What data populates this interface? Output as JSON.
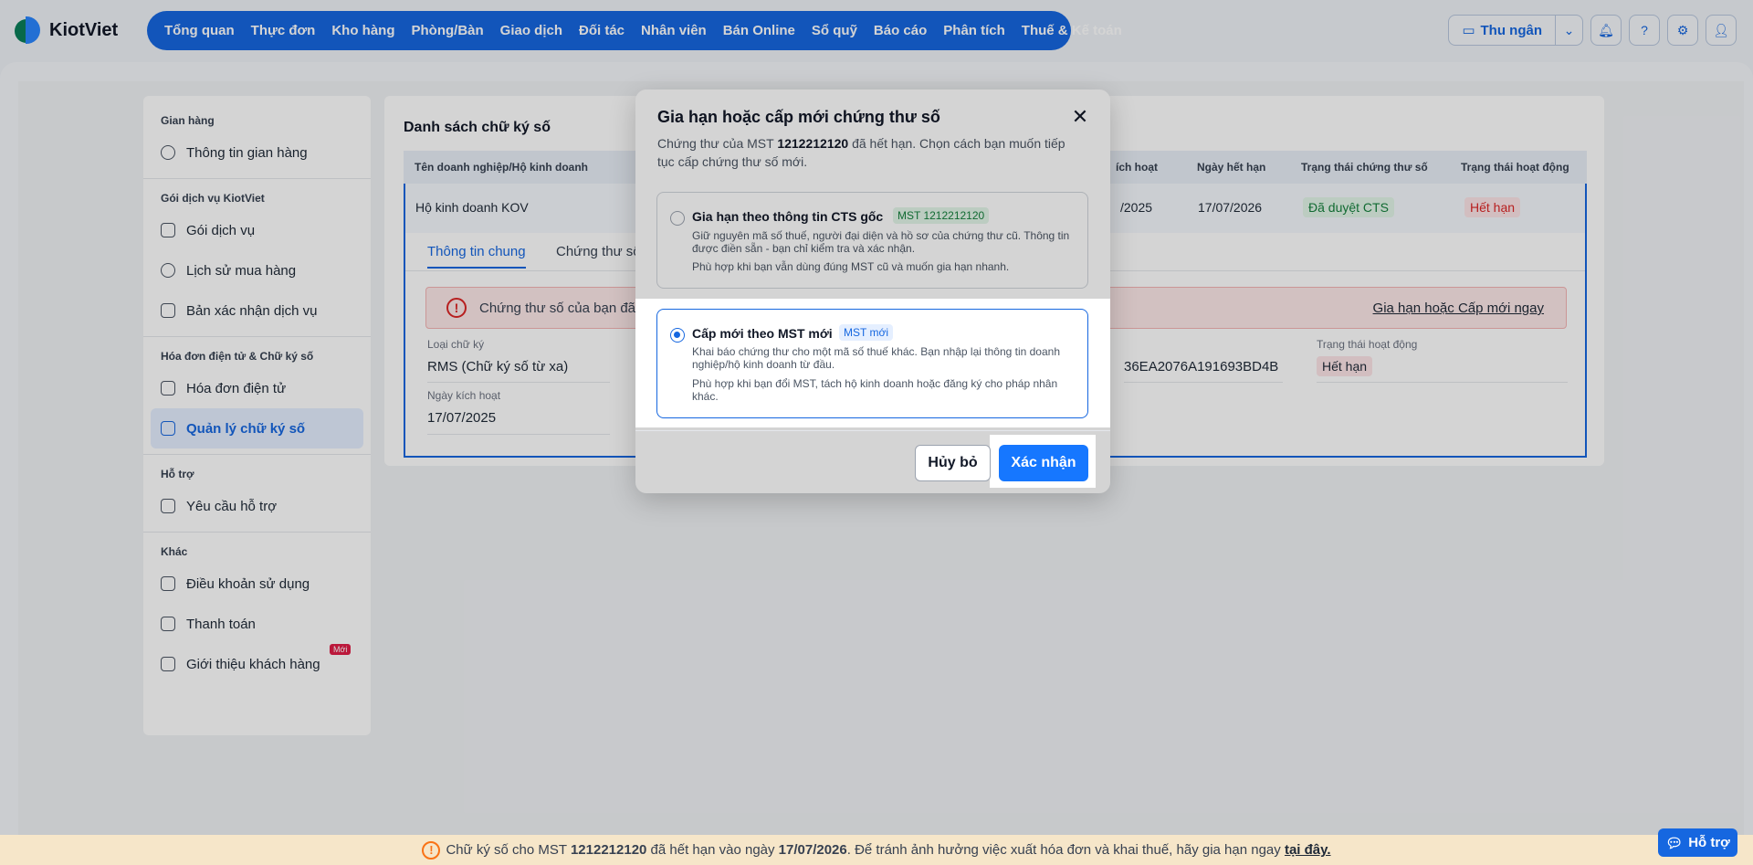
{
  "brand": {
    "name": "KiotViet"
  },
  "nav": [
    "Tổng quan",
    "Thực đơn",
    "Kho hàng",
    "Phòng/Bàn",
    "Giao dịch",
    "Đối tác",
    "Nhân viên",
    "Bán Online",
    "Sổ quỹ",
    "Báo cáo",
    "Phân tích",
    "Thuế & Kế toán"
  ],
  "toolbar": {
    "cashier_label": "Thu ngân"
  },
  "sidebar": {
    "groups": [
      {
        "title": "Gian hàng",
        "items": [
          "Thông tin gian hàng"
        ]
      },
      {
        "title": "Gói dịch vụ KiotViet",
        "items": [
          "Gói dịch vụ",
          "Lịch sử mua hàng",
          "Bản xác nhận dịch vụ"
        ]
      },
      {
        "title": "Hóa đơn điện tử & Chữ ký số",
        "items": [
          "Hóa đơn điện tử",
          "Quản lý chữ ký số"
        ]
      },
      {
        "title": "Hỗ trợ",
        "items": [
          "Yêu cầu hỗ trợ"
        ]
      },
      {
        "title": "Khác",
        "items": [
          "Điều khoản sử dụng",
          "Thanh toán",
          "Giới thiệu khách hàng"
        ]
      }
    ],
    "new_badge": "Mới"
  },
  "main": {
    "title": "Danh sách chữ ký số",
    "columns": [
      "Tên doanh nghiệp/Hộ kinh doanh",
      "ích hoạt",
      "Ngày hết hạn",
      "Trạng thái chứng thư số",
      "Trạng thái hoạt động"
    ],
    "row": {
      "name": "Hộ kinh doanh KOV",
      "activated": "/2025",
      "expiry": "17/07/2026",
      "cert_status": "Đã duyệt CTS",
      "op_status": "Hết hạn"
    },
    "tabs": [
      "Thông tin chung",
      "Chứng thư số"
    ],
    "alert": {
      "text": "Chứng thư số của bạn đã",
      "link": "Gia hạn hoặc Cấp mới ngay"
    },
    "fields": {
      "type_label": "Loại chữ ký",
      "type_value": "RMS (Chữ ký số từ xa)",
      "activated_label": "Ngày kích hoạt",
      "activated_value": "17/07/2025",
      "serial_value": "36EA2076A191693BD4B",
      "status_label": "Trạng thái hoạt động",
      "status_value": "Hết hạn"
    }
  },
  "modal": {
    "title": "Gia hạn hoặc cấp mới chứng thư số",
    "desc_prefix": "Chứng thư của MST ",
    "mst": "1212212120",
    "desc_suffix": " đã hết hạn. Chọn cách bạn muốn tiếp tục cấp chứng thư số mới.",
    "option1": {
      "title": "Gia hạn theo thông tin CTS gốc",
      "tag": "MST 1212212120",
      "desc": "Giữ nguyên mã số thuế, người đại diện và hồ sơ của chứng thư cũ. Thông tin được điền sẵn - bạn chỉ kiểm tra và xác nhận.",
      "note": "Phù hợp khi bạn vẫn dùng đúng MST cũ và muốn gia hạn nhanh."
    },
    "option2": {
      "title": "Cấp mới theo MST mới",
      "tag": "MST mới",
      "desc": "Khai báo chứng thư cho một mã số thuế khác. Bạn nhập lại thông tin doanh nghiệp/hộ kinh doanh từ đầu.",
      "note": "Phù hợp khi bạn đổi MST, tách hộ kinh doanh hoặc đăng ký cho pháp nhân khác."
    },
    "cancel_label": "Hủy bỏ",
    "confirm_label": "Xác nhận"
  },
  "banner": {
    "prefix": "Chữ ký số cho MST ",
    "mst": "1212212120",
    "middle": " đã hết hạn vào ngày ",
    "date": "17/07/2026",
    "suffix": ". Để tránh ảnh hưởng việc xuất hóa đơn và khai thuế, hãy gia hạn ngay ",
    "link": "tại đây."
  },
  "help_label": "Hỗ trợ"
}
